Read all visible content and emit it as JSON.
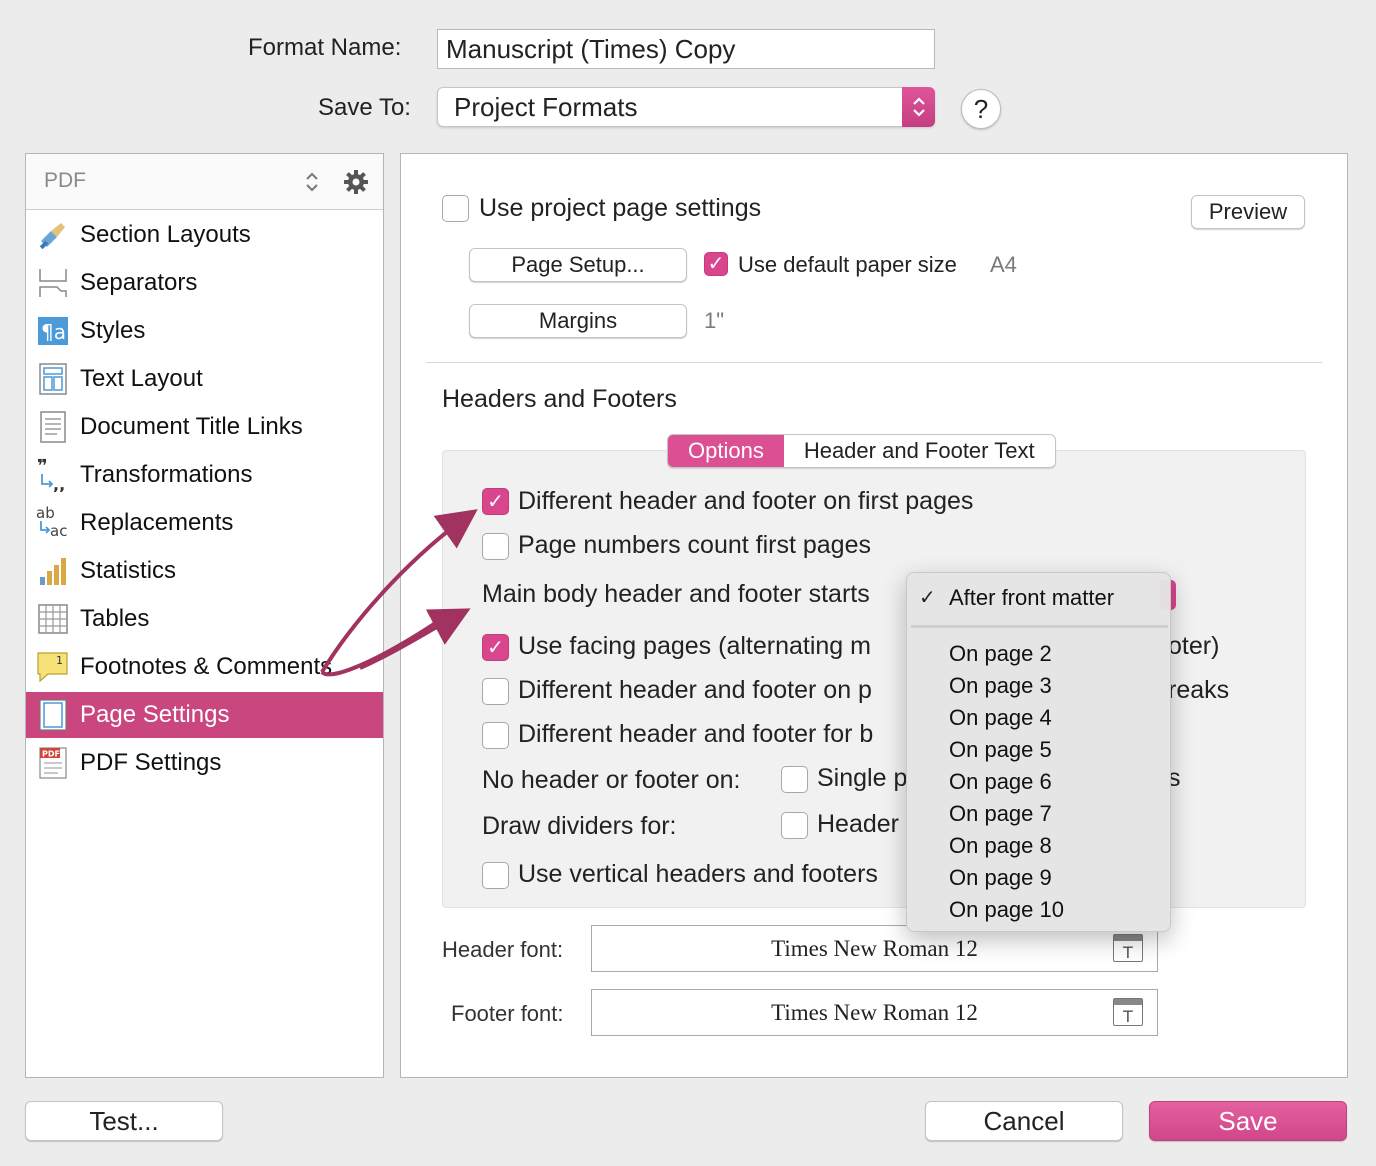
{
  "top": {
    "format_name_label": "Format Name:",
    "format_name_value": "Manuscript (Times) Copy",
    "save_to_label": "Save To:",
    "save_to_value": "Project Formats",
    "help_label": "?"
  },
  "sidebar": {
    "format": "PDF",
    "items": [
      {
        "label": "Section Layouts",
        "icon": "brush-icon"
      },
      {
        "label": "Separators",
        "icon": "separators-icon"
      },
      {
        "label": "Styles",
        "icon": "styles-icon"
      },
      {
        "label": "Text Layout",
        "icon": "text-layout-icon"
      },
      {
        "label": "Document Title Links",
        "icon": "document-icon"
      },
      {
        "label": "Transformations",
        "icon": "quotes-icon"
      },
      {
        "label": "Replacements",
        "icon": "replace-icon"
      },
      {
        "label": "Statistics",
        "icon": "bar-chart-icon"
      },
      {
        "label": "Tables",
        "icon": "table-icon"
      },
      {
        "label": "Footnotes & Comments",
        "icon": "note-icon"
      },
      {
        "label": "Page Settings",
        "icon": "page-icon",
        "selected": true
      },
      {
        "label": "PDF Settings",
        "icon": "pdf-icon"
      }
    ]
  },
  "page_settings": {
    "use_project_label": "Use project page settings",
    "use_project_checked": false,
    "preview_label": "Preview",
    "page_setup_label": "Page Setup...",
    "use_default_paper_label": "Use default paper size",
    "use_default_paper_checked": true,
    "paper_size": "A4",
    "margins_label": "Margins",
    "margins_value": "1\"",
    "section_title": "Headers and Footers",
    "tabs": [
      "Options",
      "Header and Footer Text"
    ],
    "active_tab": "Options",
    "options": {
      "diff_first": "Different header and footer on first pages",
      "page_numbers_count": "Page numbers count first pages",
      "main_body_starts": "Main body header and footer starts",
      "facing_pages_left": "Use facing pages (alternating m",
      "facing_pages_right": "oter)",
      "diff_on_p": "Different header and footer on p",
      "breaks_tail": "reaks",
      "diff_for_b": "Different header and footer for b",
      "no_header_label": "No header or footer on:",
      "single_p": "Single p",
      "s_tail": "s",
      "draw_dividers_label": "Draw dividers for:",
      "header_short": "Header",
      "vertical": "Use vertical headers and footers"
    },
    "header_font_label": "Header font:",
    "header_font": "Times New Roman 12",
    "footer_font_label": "Footer font:",
    "footer_font": "Times New Roman 12"
  },
  "menu": {
    "selected": "After front matter",
    "check": "✓",
    "items": [
      "On page 2",
      "On page 3",
      "On page 4",
      "On page 5",
      "On page 6",
      "On page 7",
      "On page 8",
      "On page 9",
      "On page 10"
    ]
  },
  "footer": {
    "test_label": "Test...",
    "cancel_label": "Cancel",
    "save_label": "Save"
  },
  "colors": {
    "accent": "#d9468d",
    "selected_row": "#c9467f",
    "arrow": "#a2325f"
  }
}
